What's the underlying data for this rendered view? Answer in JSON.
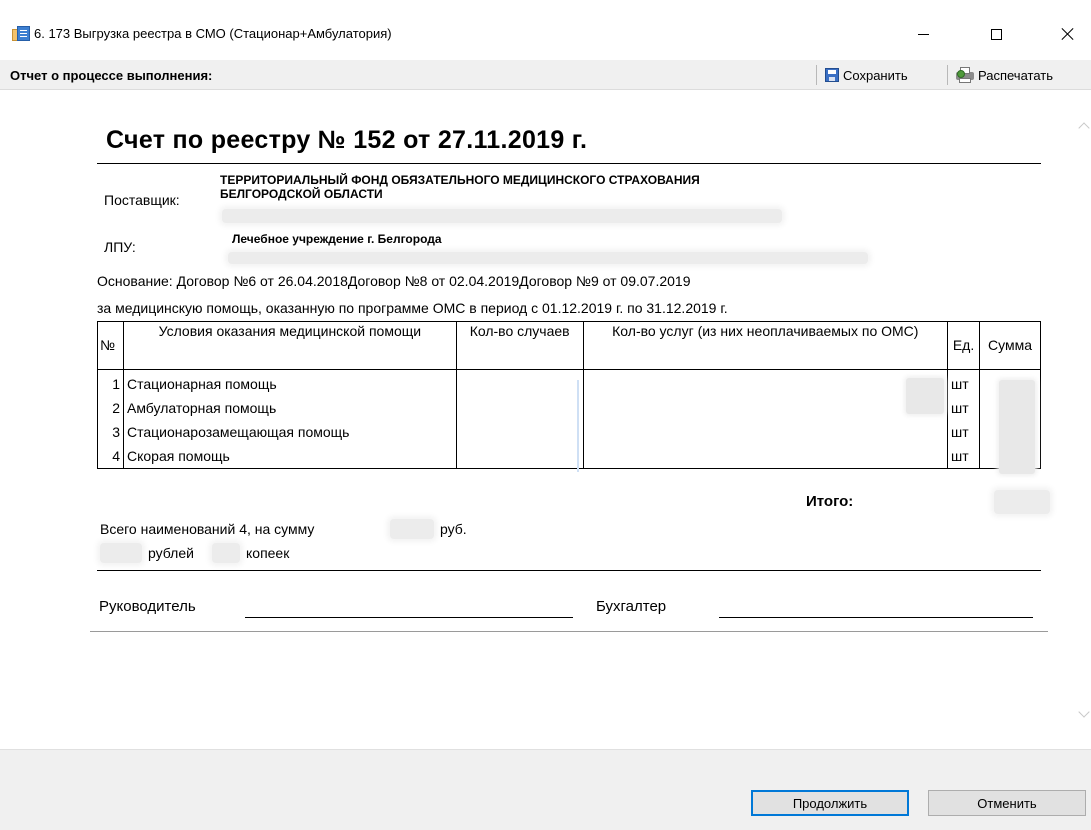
{
  "window": {
    "title": "6. 173 Выгрузка реестра в СМО (Стационар+Амбулатория)",
    "icon": "report-window-icon"
  },
  "toolbar": {
    "label": "Отчет о процессе выполнения:",
    "save_label": "Сохранить",
    "print_label": "Распечатать"
  },
  "document": {
    "title": "Счет по реестру № 152 от 27.11.2019 г.",
    "supplier_label": "Поставщик:",
    "supplier_line1": "ТЕРРИТОРИАЛЬНЫЙ ФОНД ОБЯЗАТЕЛЬНОГО МЕДИЦИНСКОГО СТРАХОВАНИЯ",
    "supplier_line2": "БЕЛГОРОДСКОЙ ОБЛАСТИ",
    "lpu_label": "ЛПУ:",
    "lpu_name": "Лечебное учреждение г. Белгорода",
    "basis_line": "Основание: Договор №6 от 26.04.2018Договор №8 от 02.04.2019Договор №9 от 09.07.2019",
    "period_line": "за медицинскую помощь, оказанную по программе ОМС в период с 01.12.2019 г. по 31.12.2019 г.",
    "table": {
      "headers": {
        "num": "№",
        "conditions": "Условия оказания медицинской помощи",
        "cases": "Кол-во случаев",
        "services": "Кол-во услуг (из них неоплачиваемых по ОМС)",
        "unit": "Ед.",
        "sum": "Сумма"
      },
      "rows": [
        {
          "num": "1",
          "condition": "Стационарная помощь",
          "unit": "шт"
        },
        {
          "num": "2",
          "condition": "Амбулаторная помощь",
          "unit": "шт"
        },
        {
          "num": "3",
          "condition": "Стационарозамещающая помощь",
          "unit": "шт"
        },
        {
          "num": "4",
          "condition": "Скорая помощь",
          "unit": "шт"
        }
      ]
    },
    "total_label": "Итого:",
    "summary_prefix": "Всего наименований 4, на сумму",
    "summary_suffix": "руб.",
    "rubles_word": "рублей",
    "kopecks_word": "копеек",
    "head_label": "Руководитель",
    "accountant_label": "Бухгалтер"
  },
  "buttons": {
    "continue": "Продолжить",
    "cancel": "Отменить"
  }
}
